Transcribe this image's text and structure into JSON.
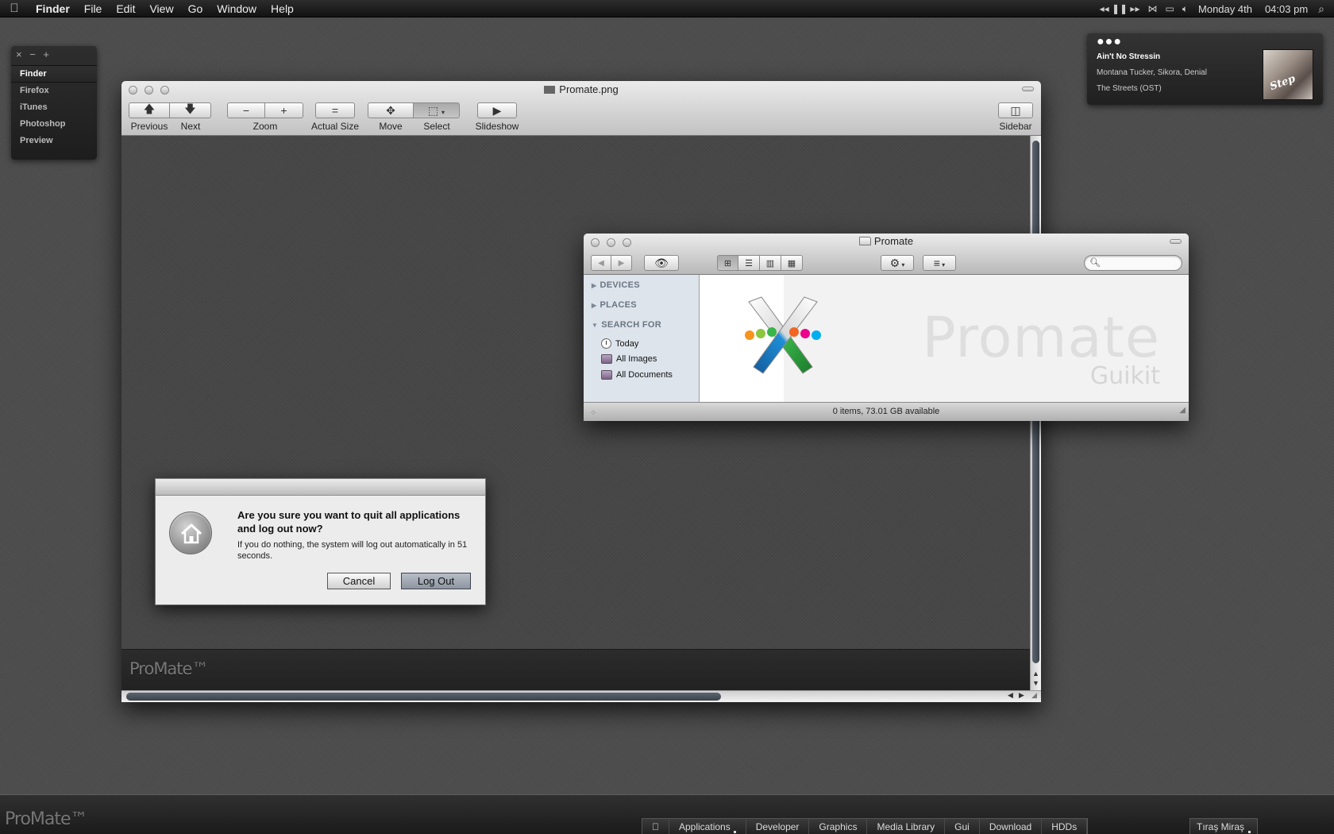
{
  "menubar": {
    "apple_icon": "apple-icon",
    "app_name": "Finder",
    "items": [
      "File",
      "Edit",
      "View",
      "Go",
      "Window",
      "Help"
    ],
    "status": {
      "media_controls": "◂◂ ❚❚ ▸▸",
      "date": "Monday 4th",
      "time": "04:03 pm"
    }
  },
  "launcher": {
    "controls": "× − +",
    "items": [
      "Finder",
      "Firefox",
      "iTunes",
      "Photoshop",
      "Preview"
    ],
    "active": "Finder"
  },
  "now_playing": {
    "title": "Ain't No Stressin",
    "artist": "Montana Tucker, Sikora, Denial",
    "album": "The Streets (OST)"
  },
  "preview_window": {
    "title": "Promate.png",
    "toolbar": {
      "previous": "Previous",
      "next": "Next",
      "zoom": "Zoom",
      "actual_size": "Actual Size",
      "move": "Move",
      "select": "Select",
      "slideshow": "Slideshow",
      "sidebar": "Sidebar"
    },
    "footer_brand": "ProMate™"
  },
  "finder_window": {
    "title": "Promate",
    "sidebar": {
      "devices": "DEVICES",
      "places": "PLACES",
      "search_for": "SEARCH FOR",
      "items": [
        "Today",
        "All Images",
        "All Documents"
      ]
    },
    "watermark_title": "Promate",
    "watermark_subtitle": "Guikit",
    "status": "0 items, 73.01 GB available",
    "search_placeholder": ""
  },
  "logout_dialog": {
    "message": "Are you sure you want to quit all applications and log out now?",
    "detail": "If you do nothing, the system will log out automatically in 51 seconds.",
    "cancel": "Cancel",
    "logout": "Log Out"
  },
  "bottom_bar": {
    "brand": "ProMate™",
    "dock": [
      "Applications",
      "Developer",
      "Graphics",
      "Media Library",
      "Gui",
      "Download",
      "HDDs"
    ],
    "user": "Tıraş Miraş"
  }
}
